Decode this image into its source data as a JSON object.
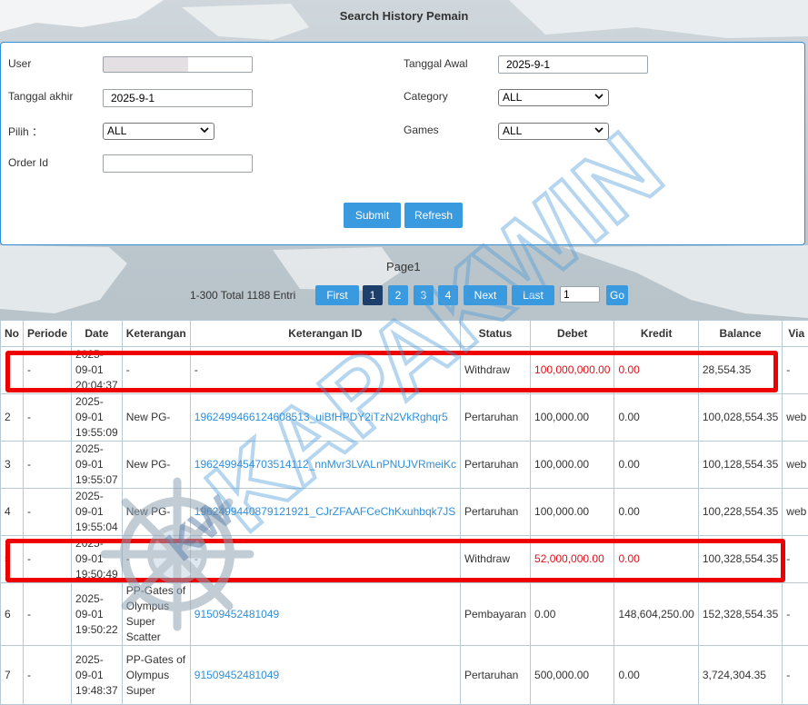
{
  "page": {
    "title": "Search History Pemain"
  },
  "form": {
    "user_label": "User",
    "user_value": "",
    "tanggal_akhir_label": "Tanggal akhir",
    "tanggal_akhir_value": "2025-9-1",
    "pilih_label": "Pilih ：",
    "pilih_value": "ALL",
    "order_id_label": "Order Id",
    "order_id_value": "",
    "tanggal_awal_label": "Tanggal Awal",
    "tanggal_awal_value": "2025-9-1",
    "category_label": "Category",
    "category_value": "ALL",
    "games_label": "Games",
    "games_value": "ALL",
    "submit_label": "Submit",
    "refresh_label": "Refresh"
  },
  "pager": {
    "page_label": "Page1",
    "info": "1-300 Total 1188 Entri",
    "first": "First",
    "pages": [
      "1",
      "2",
      "3",
      "4"
    ],
    "next": "Next",
    "last": "Last",
    "goto_value": "1",
    "go": "Go"
  },
  "table": {
    "headers": [
      "No",
      "Periode",
      "Date",
      "Keterangan",
      "Keterangan ID",
      "Status",
      "Debet",
      "Kredit",
      "Balance",
      "Via"
    ],
    "rows": [
      {
        "no": "1",
        "periode": "-",
        "date": "2025-\n09-01\n20:04:37",
        "keterangan": "-",
        "ket_id": "-",
        "status": "Withdraw",
        "debet": "100,000,000.00",
        "kredit": "0.00",
        "balance": "28,554.35",
        "via": "-"
      },
      {
        "no": "2",
        "periode": "-",
        "date": "2025-\n09-01\n19:55:09",
        "keterangan": "New PG-",
        "ket_id": "1962499466124608513_uiBfHPDY2iTzN2VkRghqr5",
        "status": "Pertaruhan",
        "debet": "100,000.00",
        "kredit": "0.00",
        "balance": "100,028,554.35",
        "via": "web"
      },
      {
        "no": "3",
        "periode": "-",
        "date": "2025-\n09-01\n19:55:07",
        "keterangan": "New PG-",
        "ket_id": "1962499454703514112_nnMvr3LVALnPNUJVRmeiKc",
        "status": "Pertaruhan",
        "debet": "100,000.00",
        "kredit": "0.00",
        "balance": "100,128,554.35",
        "via": "web"
      },
      {
        "no": "4",
        "periode": "-",
        "date": "2025-\n09-01\n19:55:04",
        "keterangan": "New PG-",
        "ket_id": "1962499440879121921_CJrZFAAFCeChKxuhbqk7JS",
        "status": "Pertaruhan",
        "debet": "100,000.00",
        "kredit": "0.00",
        "balance": "100,228,554.35",
        "via": "web"
      },
      {
        "no": "5",
        "periode": "-",
        "date": "2025-\n09-01\n19:50:49",
        "keterangan": "-",
        "ket_id": "-",
        "status": "Withdraw",
        "debet": "52,000,000.00",
        "kredit": "0.00",
        "balance": "100,328,554.35",
        "via": "-"
      },
      {
        "no": "6",
        "periode": "-",
        "date": "2025-\n09-01\n19:50:22",
        "keterangan": "PP-Gates of\nOlympus\nSuper\nScatter",
        "ket_id": "91509452481049",
        "status": "Pembayaran",
        "debet": "0.00",
        "kredit": "148,604,250.00",
        "balance": "152,328,554.35",
        "via": "-"
      },
      {
        "no": "7",
        "periode": "-",
        "date": "2025-\n09-01\n19:48:37",
        "keterangan": "PP-Gates of\nOlympus\nSuper",
        "ket_id": "91509452481049",
        "status": "Pertaruhan",
        "debet": "500,000.00",
        "kredit": "0.00",
        "balance": "3,724,304.35",
        "via": "-"
      }
    ]
  },
  "watermark": {
    "text": "KAPAKWIN",
    "logo_text": "KW"
  },
  "colors": {
    "accent": "#3a9ae0",
    "highlight": "#ee0000",
    "link": "#2f8fd8",
    "negative": "#e0101a"
  }
}
